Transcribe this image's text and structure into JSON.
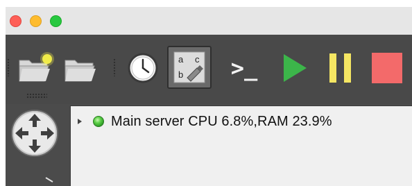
{
  "window": {
    "traffic_lights": [
      "close",
      "minimize",
      "zoom"
    ]
  },
  "toolbar": {
    "tools": [
      {
        "name": "new-project-folder-icon",
        "interactable": true
      },
      {
        "name": "open-folder-icon",
        "interactable": true
      },
      {
        "name": "clock-icon",
        "interactable": true
      },
      {
        "name": "annotate-text-icon",
        "interactable": true,
        "selected": true
      },
      {
        "name": "console-icon",
        "interactable": true
      },
      {
        "name": "play-icon",
        "interactable": true
      },
      {
        "name": "pause-icon",
        "interactable": true
      },
      {
        "name": "stop-icon",
        "interactable": true
      }
    ],
    "console_glyph": ">_",
    "annotate_letters": [
      "a",
      "c",
      "b"
    ],
    "colors": {
      "play": "#3cb54a",
      "pause": "#f5e663",
      "stop": "#f36a6a",
      "new_folder_badge": "#f7f24a"
    }
  },
  "sidebar": {
    "items": [
      {
        "name": "router-icon"
      }
    ]
  },
  "tree": {
    "rows": [
      {
        "label": "Main server CPU 6.8%,RAM 23.9%",
        "status": "running",
        "status_color": "#4cc93b",
        "expanded": false
      }
    ]
  }
}
